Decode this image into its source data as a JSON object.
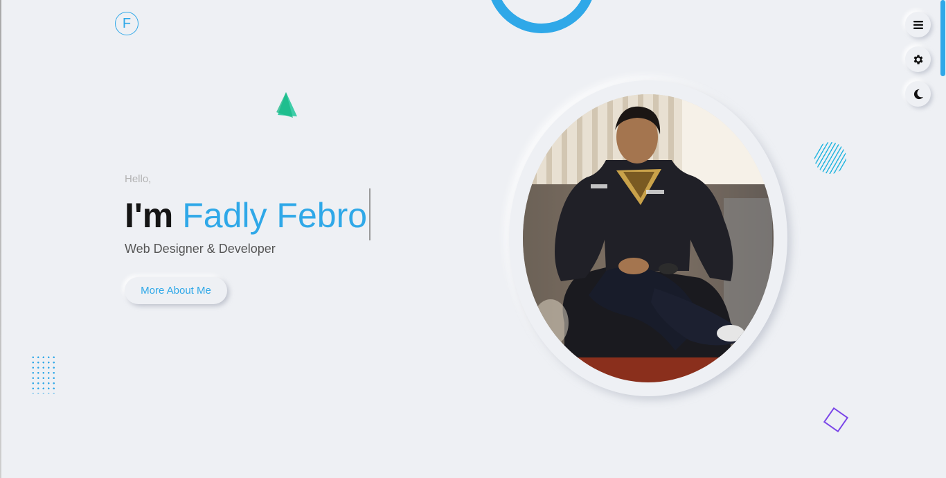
{
  "brand": {
    "logo_letter": "F"
  },
  "hero": {
    "greeting": "Hello,",
    "title_prefix": "I'm",
    "name": "Fadly Febro",
    "subtitle": "Web Designer & Developer",
    "cta_label": "More About Me"
  },
  "side_controls": [
    {
      "name": "menu",
      "icon": "menu-icon"
    },
    {
      "name": "settings",
      "icon": "gear-icon"
    },
    {
      "name": "theme",
      "icon": "moon-icon"
    }
  ],
  "colors": {
    "background": "#eef0f4",
    "accent": "#2fa8e8",
    "triangle": "#1fc79a",
    "diamond": "#7b46e8",
    "text_dark": "#151515",
    "text_muted": "#555555"
  },
  "decorations": [
    "ring-shape",
    "triangle-shape",
    "striped-circle-shape",
    "diamond-shape",
    "dot-grid-shape"
  ]
}
